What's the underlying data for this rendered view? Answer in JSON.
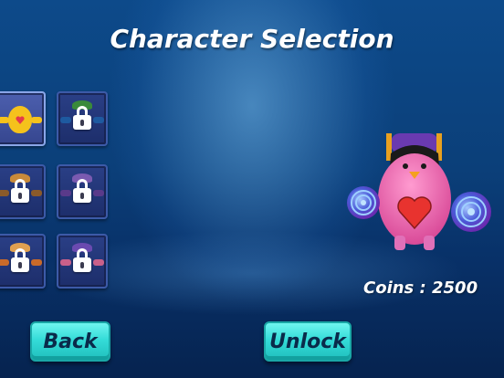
{
  "screen": {
    "title": "Character Selection"
  },
  "characters": [
    {
      "id": "yellow",
      "locked": false,
      "selected": true,
      "color": "#f5c21c",
      "accent": "#e43a4a"
    },
    {
      "id": "green",
      "locked": true,
      "selected": false,
      "color": "#1e5aa0",
      "accent": "#3a8a3a"
    },
    {
      "id": "brown",
      "locked": true,
      "selected": false,
      "color": "#8a5a2a",
      "accent": "#c98a3a"
    },
    {
      "id": "purple",
      "locked": true,
      "selected": false,
      "color": "#5a3a8a",
      "accent": "#7a5ab0"
    },
    {
      "id": "orange",
      "locked": true,
      "selected": false,
      "color": "#c96a2a",
      "accent": "#e0a050"
    },
    {
      "id": "pink",
      "locked": true,
      "selected": false,
      "color": "#c9608a",
      "accent": "#6a4ab0"
    }
  ],
  "preview": {
    "character": "pink",
    "color": "#f06ab0",
    "hat_color": "#6a3ab0",
    "heart_color": "#e8332f"
  },
  "coins": {
    "label": "Coins : 2500"
  },
  "buttons": {
    "back": "Back",
    "unlock": "Unlock"
  },
  "icons": {
    "lock": "lock-icon",
    "heart": "heart-icon"
  },
  "colors": {
    "button": "#34dcd8",
    "background": "#0b3f79"
  }
}
